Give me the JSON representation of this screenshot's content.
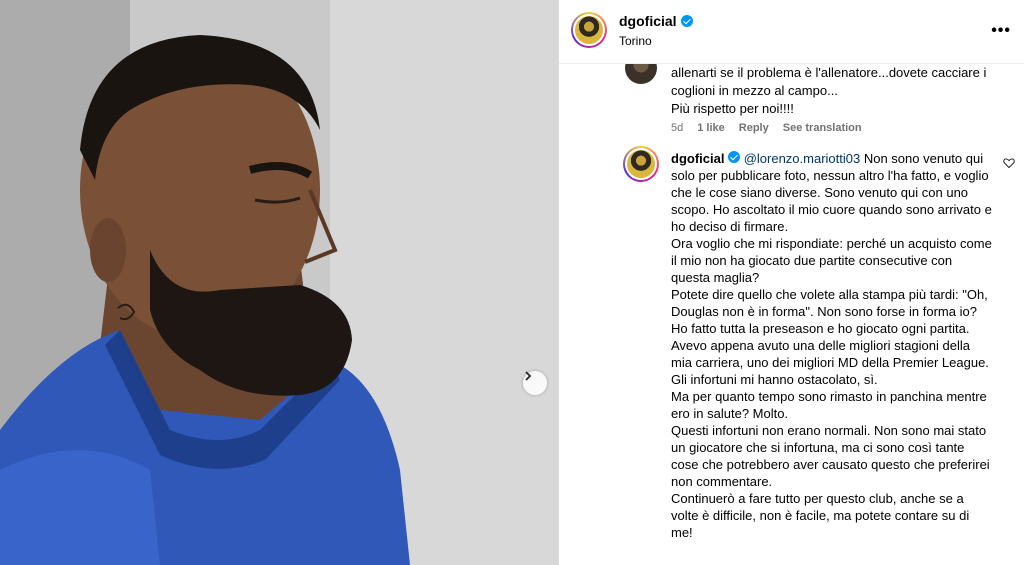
{
  "post": {
    "username": "dgoficial",
    "location": "Torino",
    "more_label": "•••"
  },
  "comments": [
    {
      "text": "allenarti se il problema è l'allenatore...dovete cacciare i coglioni in mezzo al campo...\nPiù rispetto per noi!!!!",
      "time": "5d",
      "likes": "1 like",
      "reply": "Reply",
      "translate": "See translation"
    },
    {
      "username": "dgoficial",
      "mention": "@lorenzo.mariotti03",
      "text": " Non sono venuto qui solo per pubblicare foto, nessun altro l'ha fatto, e voglio che le cose siano diverse. Sono venuto qui con uno scopo. Ho ascoltato il mio cuore quando sono arrivato e ho deciso di firmare.\nOra voglio che mi rispondiate: perché un acquisto come il mio non ha giocato due partite consecutive con questa maglia?\nPotete dire quello che volete alla stampa più tardi: \"Oh, Douglas non è in forma\". Non sono forse in forma io?\nHo fatto tutta la preseason e ho giocato ogni partita. Avevo appena avuto una delle migliori stagioni della mia carriera, uno dei migliori MD della Premier League.\nGli infortuni mi hanno ostacolato, sì.\nMa per quanto tempo sono rimasto in panchina mentre ero in salute? Molto.\nQuesti infortuni non erano normali. Non sono mai stato un giocatore che si infortuna, ma ci sono così tante cose che potrebbero aver causato questo che preferirei non commentare.\nContinuerò a fare tutto per questo club, anche se a volte è difficile, non è facile, ma potete contare su di me!"
    }
  ],
  "icons": {
    "next": "chevron-right-icon",
    "like": "heart-icon",
    "verified": "verified-badge-icon",
    "more": "more-options-icon"
  },
  "colors": {
    "verified": "#0095f6",
    "meta": "#737373",
    "mention": "#00376b"
  }
}
